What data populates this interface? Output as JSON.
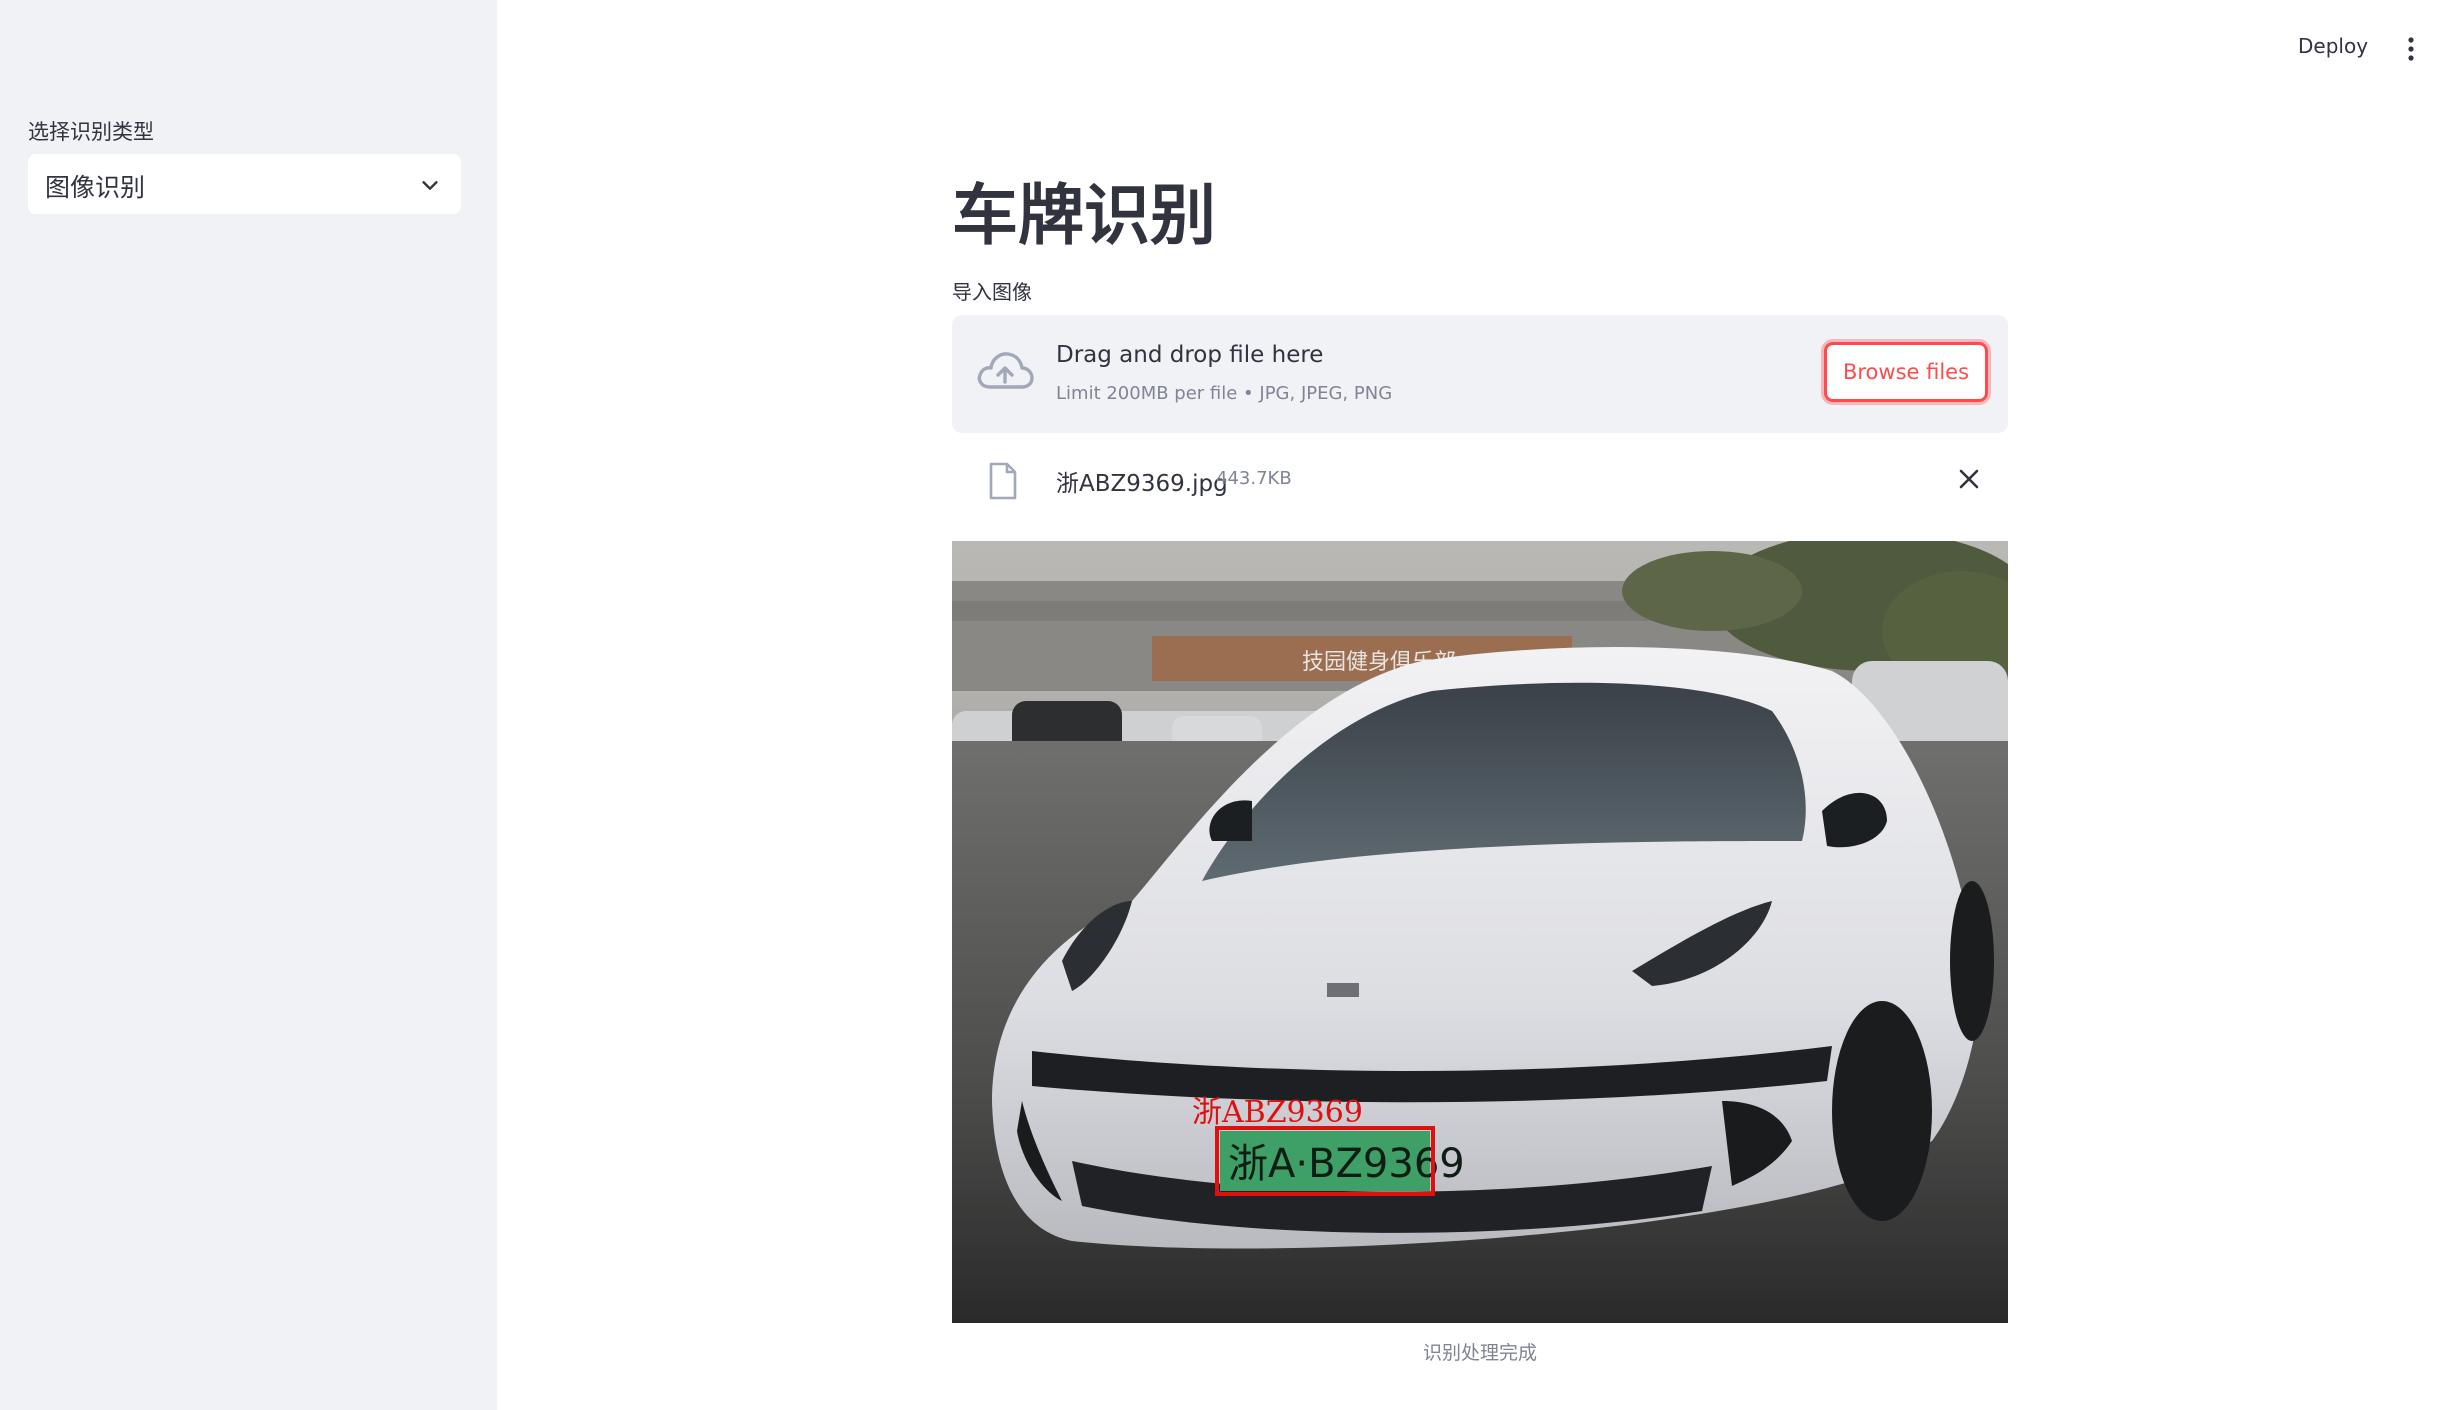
{
  "sidebar": {
    "label": "选择识别类型",
    "select_value": "图像识别",
    "chevron_icon": "chevron-down-icon"
  },
  "header": {
    "deploy_label": "Deploy",
    "menu_icon": "more-vertical-icon"
  },
  "main": {
    "title": "车牌识别",
    "upload_label": "导入图像",
    "dropzone": {
      "icon": "cloud-upload-icon",
      "main_text": "Drag and drop file here",
      "sub_text": "Limit 200MB per file • JPG, JPEG, PNG",
      "browse_label": "Browse files"
    },
    "file": {
      "icon": "file-icon",
      "name": "浙ABZ9369.jpg",
      "size": "443.7KB",
      "close_icon": "close-icon"
    },
    "image": {
      "plate_text": "浙A·BZ9369",
      "detection_label": "浙ABZ9369",
      "sign_text": "技园健身俱乐部"
    },
    "caption": "识别处理完成"
  },
  "colors": {
    "accent": "#ff4b4b",
    "sidebar_bg": "#f0f2f6",
    "text": "#31333f",
    "muted": "#808495",
    "box": "#e01010",
    "plate_green": "#3fa067"
  }
}
